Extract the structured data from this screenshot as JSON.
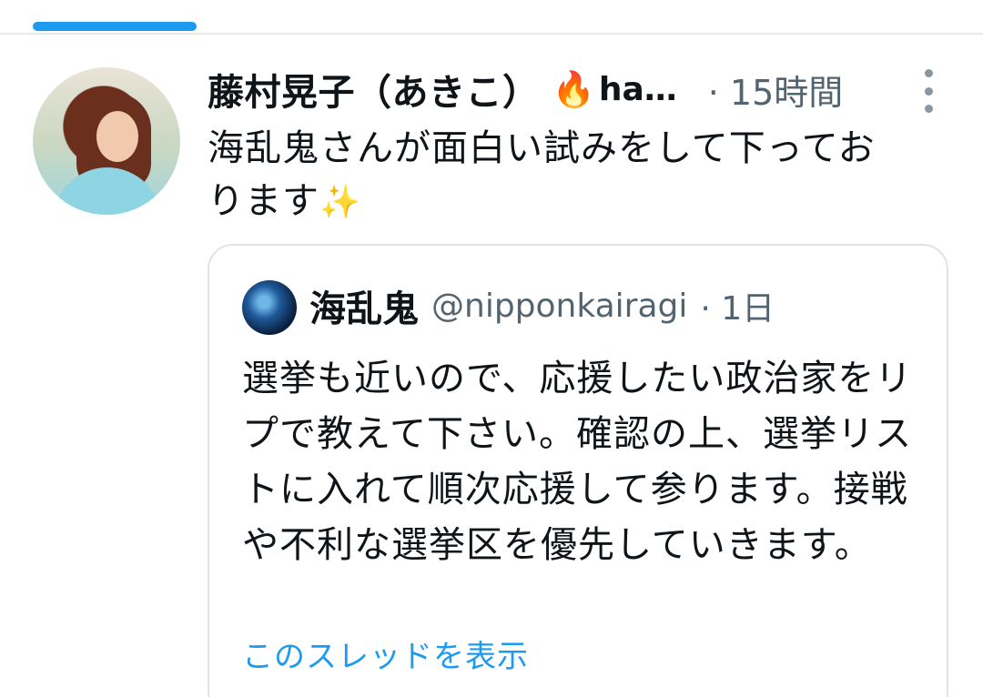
{
  "tweet": {
    "display_name": "藤村晃子（あきこ）",
    "name_emoji": "🔥",
    "handle_truncated": "ha…",
    "time": "· 15時間",
    "text_line1": "海乱鬼さんが面白い試みをして下ってお",
    "text_line2": "ります",
    "text_emoji": "✨"
  },
  "quote": {
    "display_name": "海乱鬼",
    "handle": "@nipponkairagi",
    "time": "· 1日",
    "text": "選挙も近いので、応援したい政治家をリプで教えて下さい。確認の上、選挙リストに入れて順次応援して参ります。接戦や不利な選挙区を優先していきます。",
    "show_thread": "このスレッドを表示"
  },
  "colors": {
    "accent": "#1d9bf0",
    "text": "#0f1419",
    "muted": "#536471",
    "border": "#dfe3e7"
  }
}
